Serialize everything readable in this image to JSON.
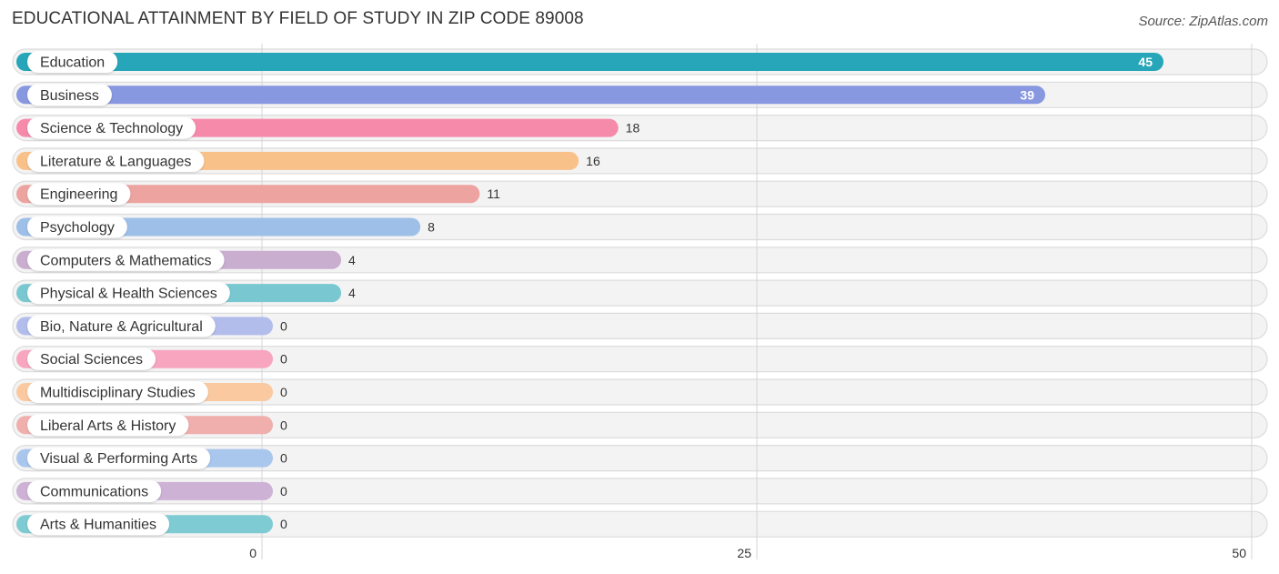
{
  "header": {
    "title": "EDUCATIONAL ATTAINMENT BY FIELD OF STUDY IN ZIP CODE 89008",
    "source": "Source: ZipAtlas.com"
  },
  "chart_data": {
    "type": "bar",
    "orientation": "horizontal",
    "title": "EDUCATIONAL ATTAINMENT BY FIELD OF STUDY IN ZIP CODE 89008",
    "xlabel": "",
    "ylabel": "",
    "xlim": [
      0,
      50
    ],
    "xticks": [
      0,
      25,
      50
    ],
    "grid": true,
    "categories": [
      "Education",
      "Business",
      "Science & Technology",
      "Literature & Languages",
      "Engineering",
      "Psychology",
      "Computers & Mathematics",
      "Physical & Health Sciences",
      "Bio, Nature & Agricultural",
      "Social Sciences",
      "Multidisciplinary Studies",
      "Liberal Arts & History",
      "Visual & Performing Arts",
      "Communications",
      "Arts & Humanities"
    ],
    "values": [
      45,
      39,
      18,
      16,
      11,
      8,
      4,
      4,
      0,
      0,
      0,
      0,
      0,
      0,
      0
    ],
    "colors": [
      "#26a6b8",
      "#8898e0",
      "#f68aab",
      "#f9c18a",
      "#eda39f",
      "#9dbfe8",
      "#c9aed0",
      "#79c8d1",
      "#b3bdec",
      "#f8a6c0",
      "#fac9a0",
      "#f0aead",
      "#a9c6ed",
      "#cdb2d6",
      "#7ecbd3"
    ]
  }
}
